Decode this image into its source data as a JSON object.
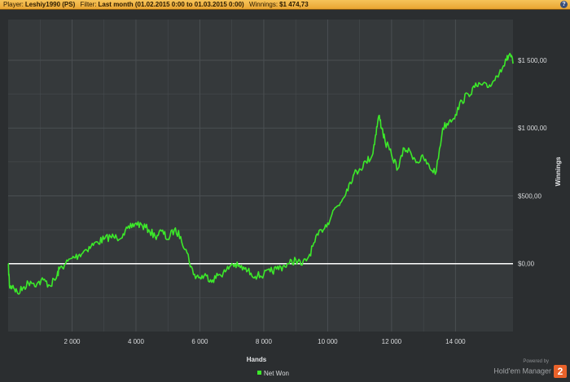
{
  "header": {
    "player_label": "Player:",
    "player_value": "Leshiy1990 (PS)",
    "filter_label": "Filter:",
    "filter_value": "Last month (01.02.2015 0:00 to 01.03.2015 0:00)",
    "winnings_label": "Winnings:",
    "winnings_value": "$1 474,73",
    "help_glyph": "?"
  },
  "branding": {
    "powered": "Powered by",
    "name": "Hold'em Manager",
    "badge": "2"
  },
  "colors": {
    "line": "#3ce82a",
    "background": "#2b2e30",
    "plot_bg": "#35393b",
    "grid": "#4a4f52",
    "zero_line": "#ffffff"
  },
  "chart_data": {
    "type": "line",
    "xlabel": "Hands",
    "ylabel": "Winnings",
    "xlim": [
      0,
      15800
    ],
    "ylim": [
      -500,
      1800
    ],
    "x_ticks": [
      2000,
      4000,
      6000,
      8000,
      10000,
      12000,
      14000
    ],
    "x_tick_labels": [
      "2 000",
      "4 000",
      "6 000",
      "8 000",
      "10 000",
      "12 000",
      "14 000"
    ],
    "y_ticks": [
      0,
      500,
      1000,
      1500
    ],
    "y_tick_labels": [
      "$0,00",
      "$500,00",
      "$1 000,00",
      "$1 500,00"
    ],
    "grid": true,
    "legend_position": "bottom-center",
    "series": [
      {
        "name": "Net Won",
        "x": [
          0,
          50,
          150,
          300,
          500,
          700,
          900,
          1100,
          1300,
          1500,
          1600,
          1800,
          2000,
          2200,
          2400,
          2600,
          2800,
          3000,
          3200,
          3400,
          3600,
          3800,
          4000,
          4200,
          4400,
          4600,
          4800,
          5000,
          5200,
          5400,
          5600,
          5800,
          6000,
          6200,
          6400,
          6600,
          6800,
          7000,
          7200,
          7400,
          7600,
          7800,
          8000,
          8200,
          8400,
          8600,
          8800,
          9000,
          9200,
          9400,
          9600,
          9800,
          10000,
          10200,
          10400,
          10600,
          10800,
          11000,
          11200,
          11400,
          11500,
          11600,
          11700,
          11800,
          12000,
          12200,
          12400,
          12600,
          12800,
          13000,
          13200,
          13400,
          13600,
          13800,
          14000,
          14200,
          14400,
          14600,
          14800,
          15000,
          15200,
          15400,
          15600,
          15700,
          15800
        ],
        "y": [
          0,
          -180,
          -160,
          -220,
          -170,
          -130,
          -150,
          -120,
          -160,
          -110,
          -40,
          0,
          40,
          60,
          100,
          130,
          160,
          180,
          200,
          190,
          220,
          260,
          300,
          280,
          250,
          200,
          240,
          180,
          250,
          200,
          80,
          -80,
          -100,
          -90,
          -120,
          -80,
          -60,
          0,
          -20,
          -40,
          -70,
          -90,
          -80,
          -60,
          -40,
          -20,
          0,
          30,
          -10,
          50,
          160,
          250,
          300,
          400,
          450,
          550,
          650,
          700,
          750,
          800,
          950,
          1090,
          1000,
          900,
          800,
          700,
          850,
          820,
          750,
          780,
          700,
          680,
          1000,
          1050,
          1100,
          1200,
          1250,
          1300,
          1320,
          1300,
          1350,
          1430,
          1500,
          1550,
          1475
        ]
      }
    ]
  }
}
